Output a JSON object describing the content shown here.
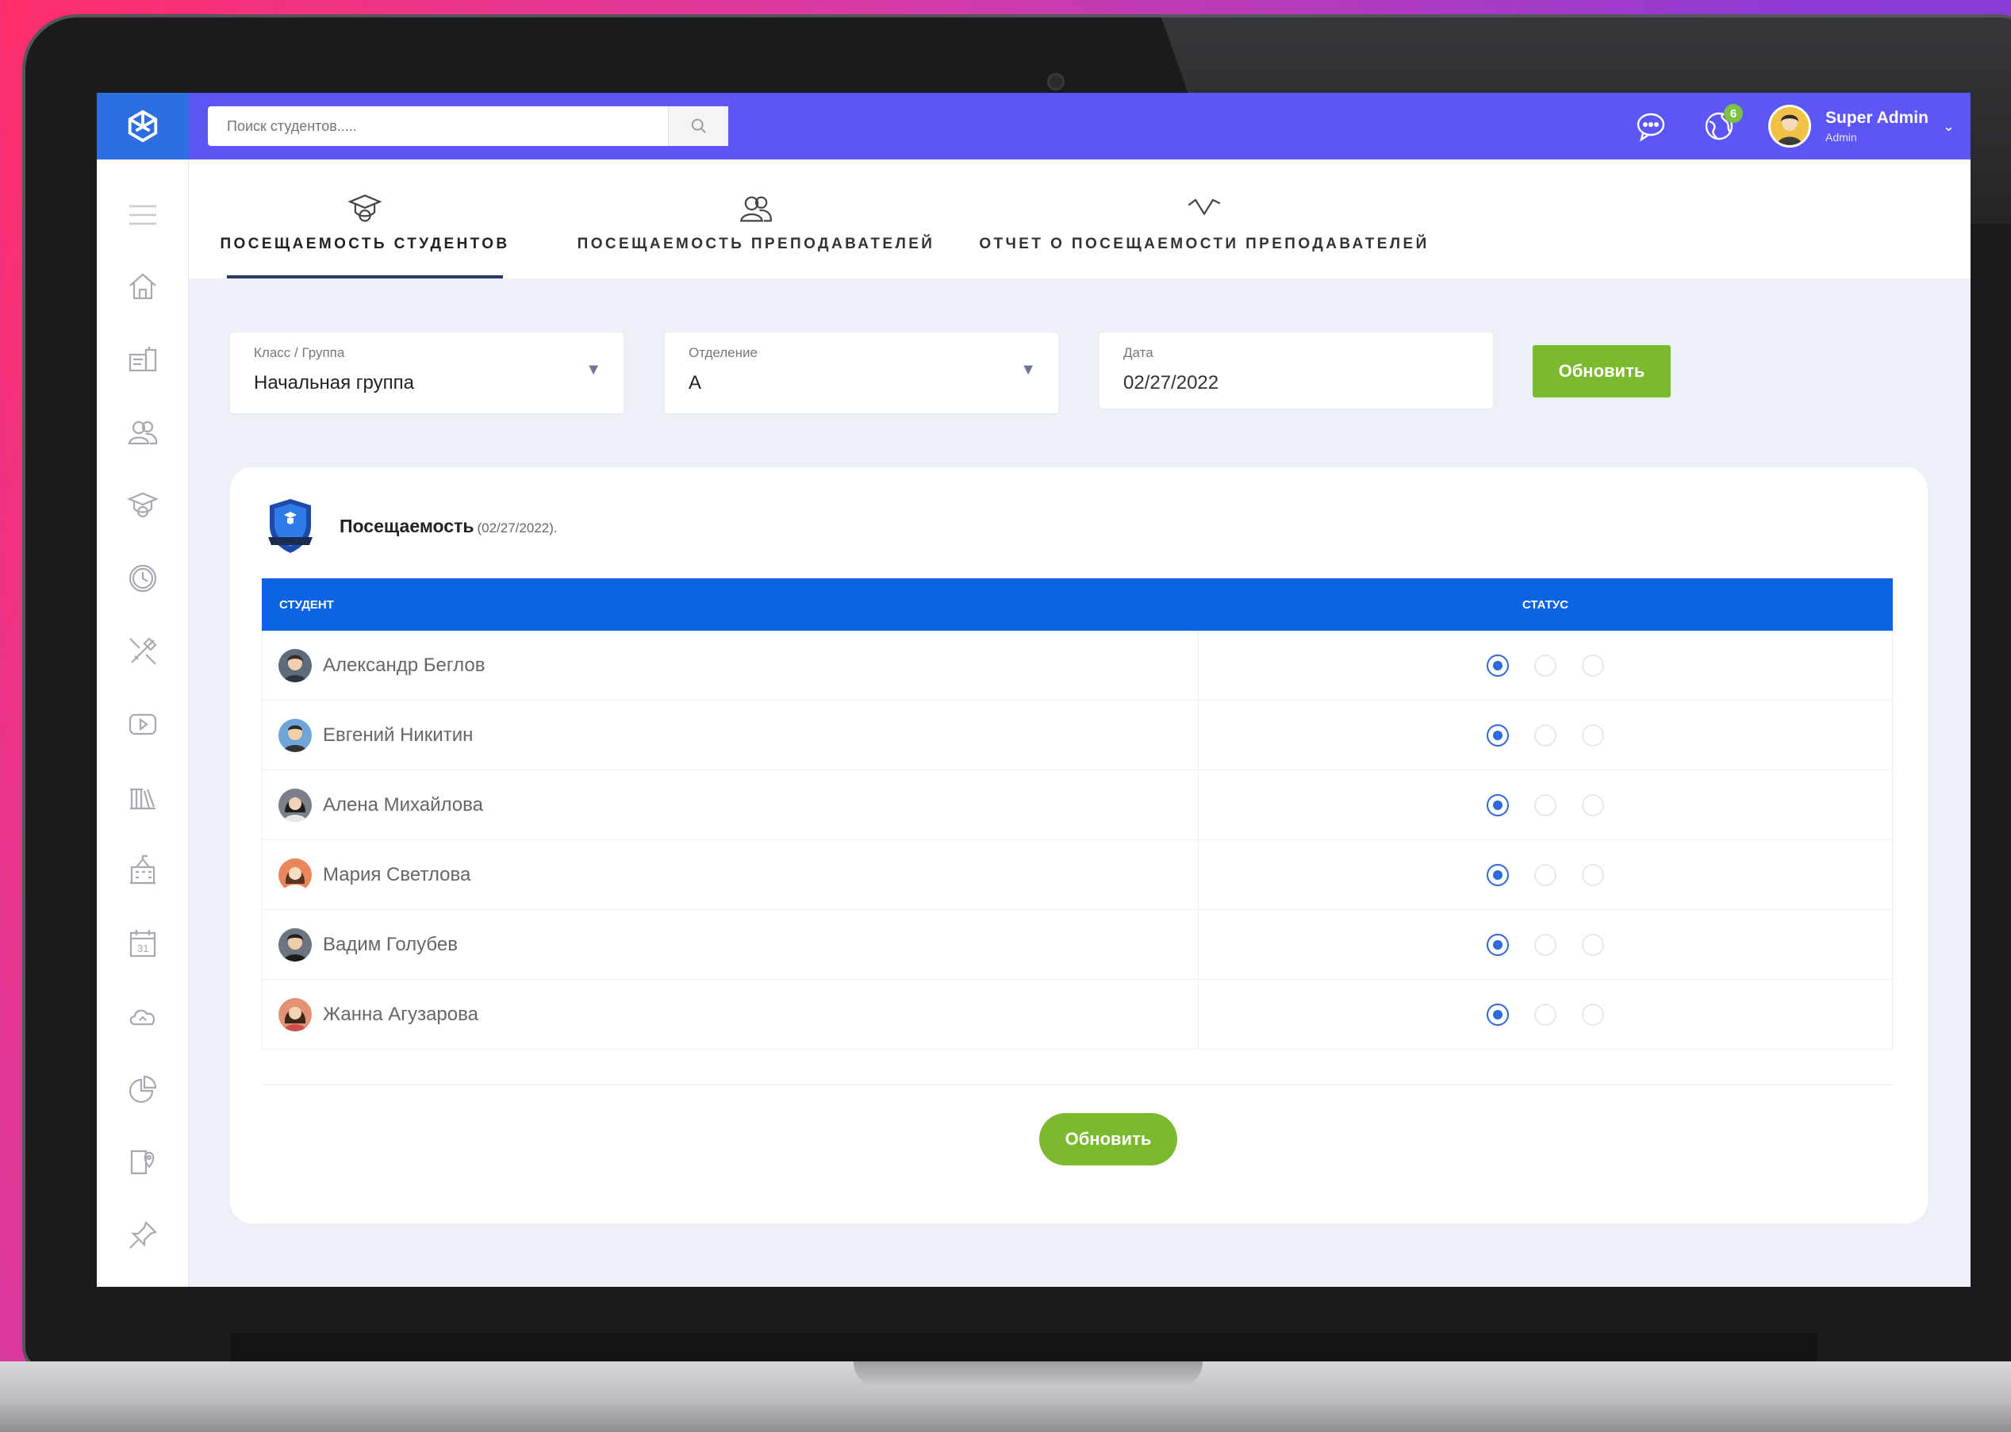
{
  "search": {
    "placeholder": "Поиск студентов....."
  },
  "topbar": {
    "notification_count": "6",
    "user_name": "Super Admin",
    "user_role": "Admin"
  },
  "tabs": [
    {
      "label": "ПОСЕЩАЕМОСТЬ СТУДЕНТОВ",
      "icon": "graduation-cap-icon",
      "active": true
    },
    {
      "label": "ПОСЕЩАЕМОСТЬ ПРЕПОДАВАТЕЛЕЙ",
      "icon": "users-icon",
      "active": false
    },
    {
      "label": "ОТЧЕТ О ПОСЕЩАЕМОСТИ ПРЕПОДАВАТЕЛЕЙ",
      "icon": "activity-icon",
      "active": false
    }
  ],
  "filters": {
    "class_label": "Класс / Группа",
    "class_value": "Начальная группа",
    "section_label": "Отделение",
    "section_value": "А",
    "date_label": "Дата",
    "date_value": "02/27/2022",
    "update_label": "Обновить"
  },
  "card": {
    "title": "Посещаемость",
    "title_date": "(02/27/2022)."
  },
  "table": {
    "col_student": "СТУДЕНТ",
    "col_status": "СТАТУС",
    "rows": [
      {
        "name": "Александр Беглов",
        "status_selected": 0
      },
      {
        "name": "Евгений Никитин",
        "status_selected": 0
      },
      {
        "name": "Алена Михайлова",
        "status_selected": 0
      },
      {
        "name": "Мария Светлова",
        "status_selected": 0
      },
      {
        "name": "Вадим Голубев",
        "status_selected": 0
      },
      {
        "name": "Жанна Агузарова",
        "status_selected": 0
      }
    ]
  },
  "footer": {
    "update_label": "Обновить"
  },
  "colors": {
    "topbar": "#5b56f5",
    "logo_bg": "#2d6fe0",
    "table_header": "#0c63e4",
    "accent_green": "#7bb92f",
    "radio_checked": "#2f68d8"
  },
  "sidebar_icons": [
    "menu-icon",
    "home-icon",
    "board-icon",
    "users-icon",
    "graduation-cap-icon",
    "clock-icon",
    "tools-icon",
    "video-icon",
    "library-icon",
    "building-icon",
    "calendar-icon",
    "cloud-icon",
    "chart-icon",
    "map-icon",
    "pin-icon"
  ]
}
